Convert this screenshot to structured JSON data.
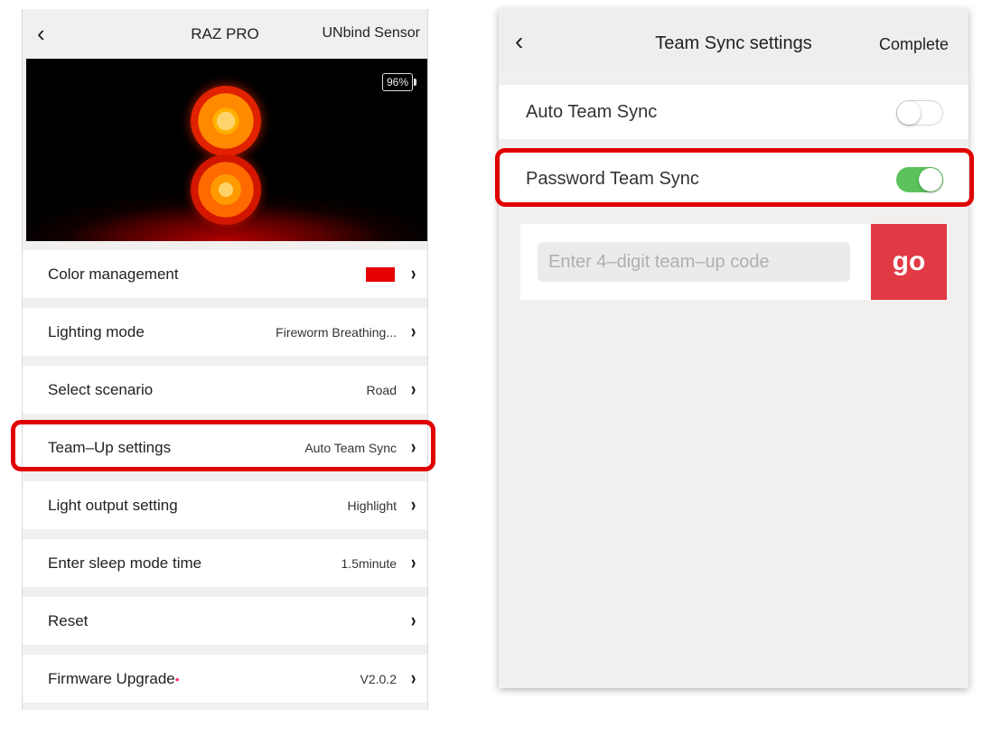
{
  "left_screen": {
    "header": {
      "back_glyph": "‹",
      "title": "RAZ PRO",
      "action": "UNbind Sensor"
    },
    "hero": {
      "battery": "96%"
    },
    "rows": [
      {
        "label": "Color management",
        "value": "",
        "swatch_color": "#e50000"
      },
      {
        "label": "Lighting mode",
        "value": "Fireworm Breathing..."
      },
      {
        "label": "Select scenario",
        "value": "Road"
      },
      {
        "label": "Team–Up settings",
        "value": "Auto Team Sync"
      },
      {
        "label": "Light output setting",
        "value": "Highlight"
      },
      {
        "label": "Enter sleep mode time",
        "value": "1.5minute"
      },
      {
        "label": "Reset",
        "value": ""
      },
      {
        "label": "Firmware Upgrade",
        "value": "V2.0.2",
        "dot": "•"
      }
    ],
    "chevron_glyph": "›"
  },
  "right_screen": {
    "header": {
      "back_glyph": "‹",
      "title": "Team Sync settings",
      "action": "Complete"
    },
    "auto_sync": {
      "label": "Auto Team Sync",
      "enabled": false
    },
    "password_sync": {
      "label": "Password Team Sync",
      "enabled": true
    },
    "code": {
      "placeholder": "Enter 4–digit team–up code",
      "value": "",
      "go_label": "go"
    }
  },
  "colors": {
    "highlight": "#e00000",
    "toggle_on": "#5cc35c",
    "go_button": "#e23a45",
    "swatch": "#e50000"
  }
}
